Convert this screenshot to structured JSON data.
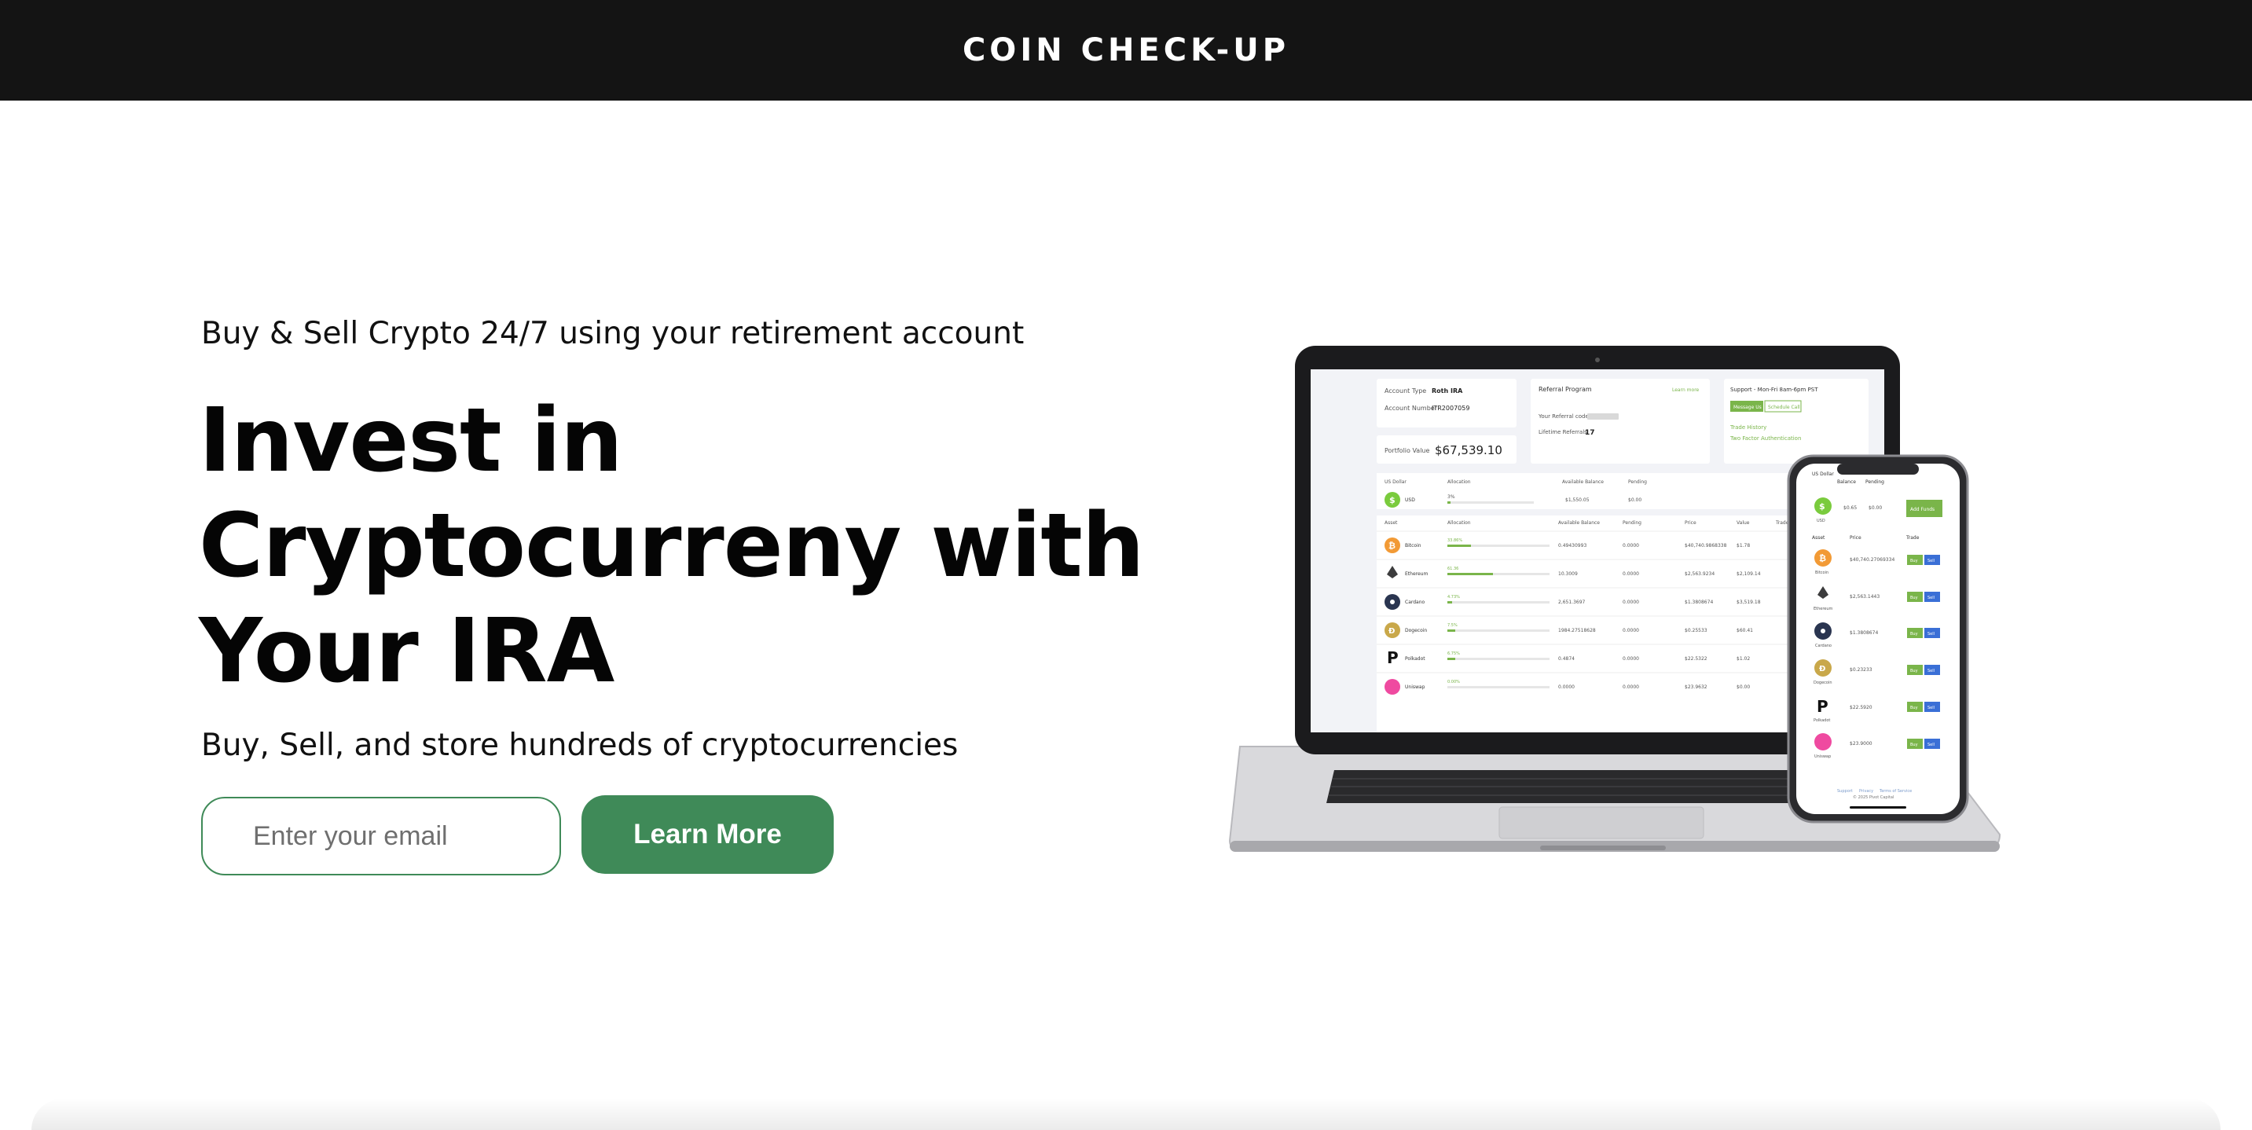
{
  "header": {
    "brand": "COIN CHECK-UP"
  },
  "hero": {
    "subhead": "Buy & Sell Crypto 24/7 using your retirement account",
    "title_lines": [
      "Invest in",
      "Cryptocurreny with",
      "Your IRA"
    ],
    "tagline": "Buy, Sell, and store hundreds of cryptocurrencies",
    "email_placeholder": "Enter your email",
    "cta_label": "Learn More"
  },
  "colors": {
    "header_bg": "#141414",
    "accent_green": "#3f8a58",
    "text": "#0b0b0b"
  },
  "mockup": {
    "laptop": {
      "account_type_label": "Account Type",
      "account_type_value": "Roth IRA",
      "account_number_label": "Account Number",
      "account_number_value": "ITR2007059",
      "portfolio_label": "Portfolio Value",
      "portfolio_value": "$67,539.10",
      "referral_title": "Referral Program",
      "learn_more": "Learn more",
      "referral_code_label": "Your Referral code",
      "lifetime_referrals_label": "Lifetime Referrals",
      "lifetime_referrals_value": "17",
      "support_title": "Support - Mon-Fri 8am-6pm PST",
      "message_us": "Message Us",
      "schedule_call": "Schedule Call",
      "trade_history": "Trade History",
      "two_factor": "Two Factor Authentication",
      "usd_header": "US Dollar",
      "allocation_header": "Allocation",
      "available_header": "Available Balance",
      "pending_header": "Pending",
      "usd_row": {
        "name": "USD",
        "alloc": "3%",
        "available": "$1,550.05",
        "pending": "$0.00"
      },
      "asset_headers": [
        "Asset",
        "Allocation",
        "Available Balance",
        "Pending",
        "Price",
        "Value",
        "Trade"
      ],
      "assets": [
        {
          "name": "Bitcoin",
          "alloc": "33.86%",
          "bal": "0.49430993",
          "pend": "0.0000",
          "price": "$40,740.9868338",
          "value": "$1.78"
        },
        {
          "name": "Ethereum",
          "alloc": "61.36",
          "bal": "10.3009",
          "pend": "0.0000",
          "price": "$2,563.9234",
          "value": "$2,109.14"
        },
        {
          "name": "Cardano",
          "alloc": "4.73%",
          "bal": "2,651.3697",
          "pend": "0.0000",
          "price": "$1.3808674",
          "value": "$3,519.18"
        },
        {
          "name": "Dogecoin",
          "alloc": "7.5%",
          "bal": "1984.27518628",
          "pend": "0.0000",
          "price": "$0.25533",
          "value": "$60.41"
        },
        {
          "name": "Polkadot",
          "alloc": "6.75%",
          "bal": "0.4874",
          "pend": "0.0000",
          "price": "$22.5322",
          "value": "$1.02"
        },
        {
          "name": "Uniswap",
          "alloc": "0.00%",
          "bal": "0.0000",
          "pend": "0.0000",
          "price": "$23.9632",
          "value": "$0.00"
        }
      ]
    },
    "phone": {
      "us_dollar": "US Dollar",
      "balance": "Balance",
      "pending": "Pending",
      "usd_balance": "$0.65",
      "usd_pending": "$0.00",
      "usd_label": "USD",
      "add_funds": "Add Funds",
      "asset_headers": [
        "Asset",
        "Price",
        "Trade"
      ],
      "buy": "Buy",
      "sell": "Sell",
      "assets": [
        {
          "name": "Bitcoin",
          "price": "$40,740.27069334"
        },
        {
          "name": "Ethereum",
          "price": "$2,563.1443"
        },
        {
          "name": "Cardano",
          "price": "$1.3808674"
        },
        {
          "name": "Dogecoin",
          "price": "$0.23233"
        },
        {
          "name": "Polkadot",
          "price": "$22.5920"
        },
        {
          "name": "Uniswap",
          "price": "$23.9000"
        }
      ],
      "footer_links": [
        "Support",
        "Privacy",
        "Terms of Service"
      ],
      "copyright": "© 2025 Pivot Capital"
    }
  }
}
